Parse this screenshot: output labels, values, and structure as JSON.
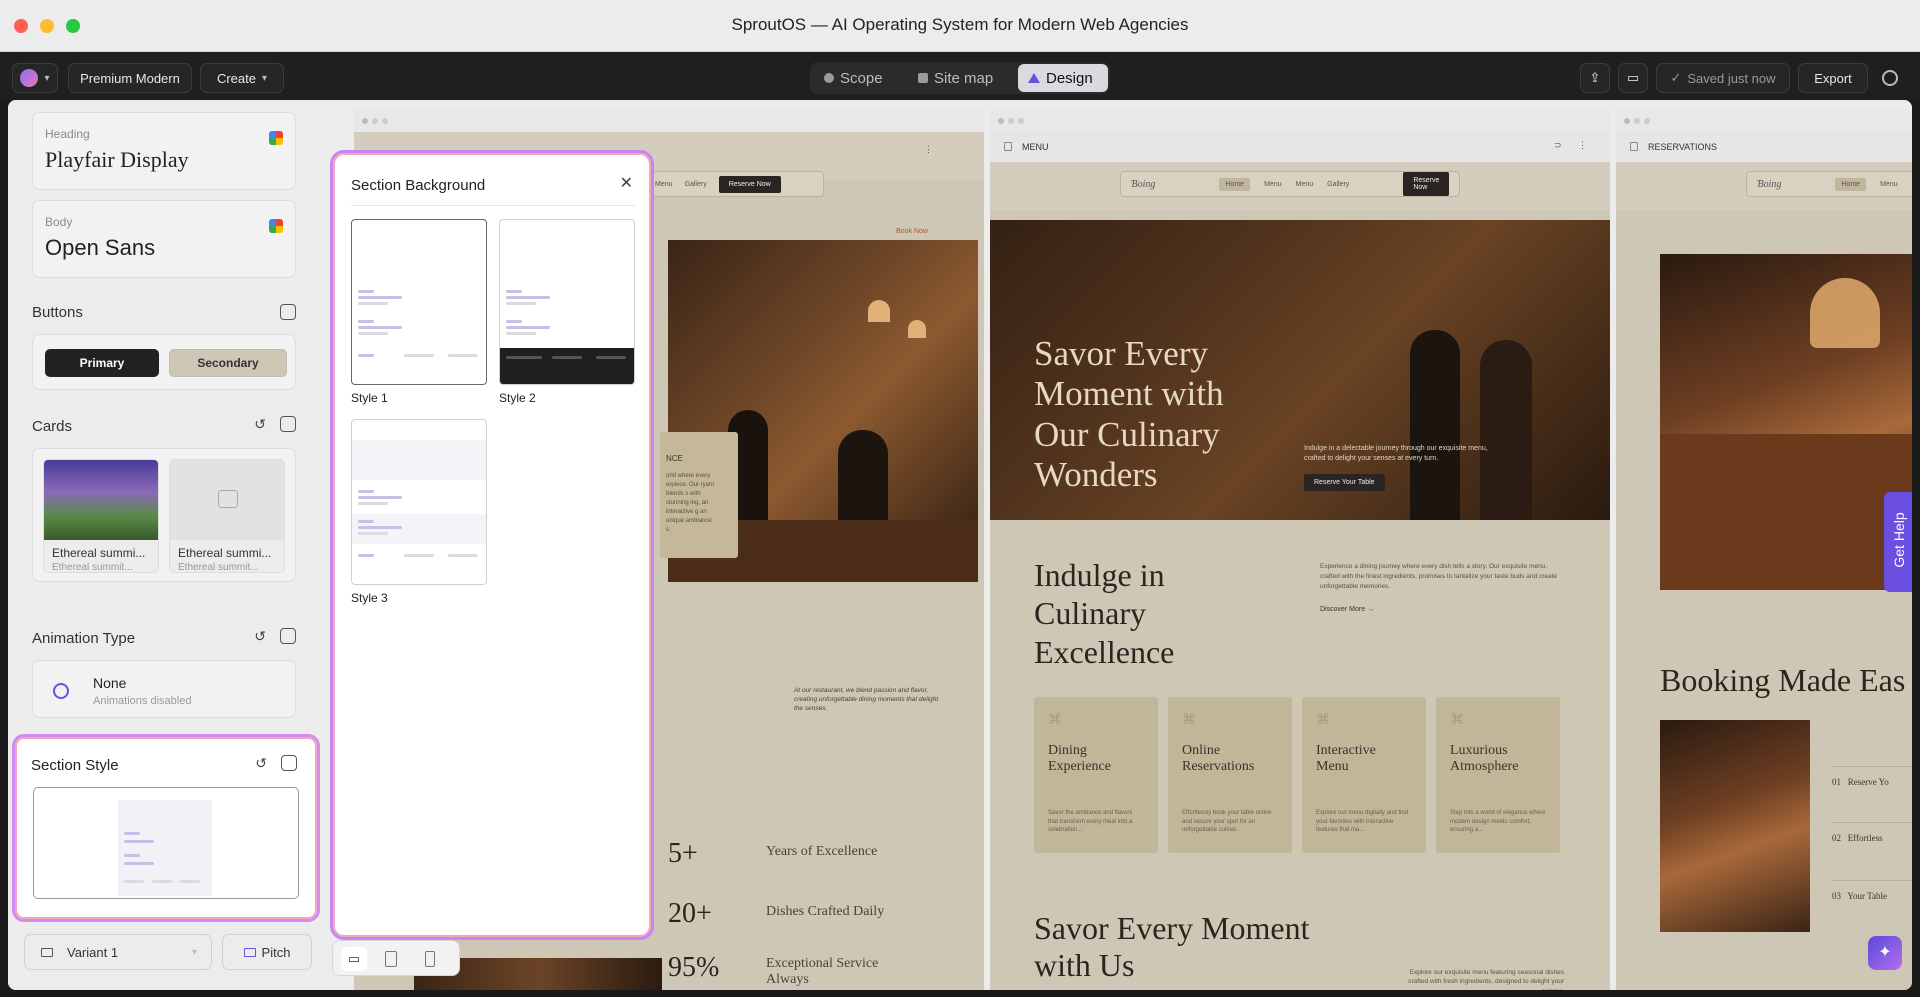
{
  "window": {
    "title": "SproutOS — AI Operating System for Modern Web Agencies"
  },
  "toolbar": {
    "theme_label": "Premium Modern",
    "create_label": "Create",
    "tabs": [
      {
        "label": "Scope"
      },
      {
        "label": "Site map"
      },
      {
        "label": "Design"
      }
    ],
    "saved_label": "Saved just now",
    "export_label": "Export"
  },
  "sidebar": {
    "heading_font": {
      "label": "Heading",
      "value": "Playfair Display"
    },
    "body_font": {
      "label": "Body",
      "value": "Open Sans"
    },
    "buttons": {
      "title": "Buttons",
      "primary": "Primary",
      "secondary": "Secondary"
    },
    "cards": {
      "title": "Cards",
      "items": [
        {
          "title": "Ethereal summi...",
          "subtitle": "Ethereal summit..."
        },
        {
          "title": "Ethereal summi...",
          "subtitle": "Ethereal summit..."
        }
      ]
    },
    "animation": {
      "title": "Animation Type",
      "value": "None",
      "desc": "Animations disabled"
    },
    "section_style": {
      "title": "Section Style"
    },
    "variant_label": "Variant 1",
    "pitch_label": "Pitch"
  },
  "popover": {
    "title": "Section Background",
    "styles": [
      {
        "label": "Style 1"
      },
      {
        "label": "Style 2"
      },
      {
        "label": "Style 3"
      }
    ]
  },
  "preview1": {
    "nav": [
      "Menu",
      "Gallery"
    ],
    "nav_button": "Reserve Now",
    "book_link": "Book Now",
    "partial_heading": "NCE",
    "partial_text": "orld where every erpiece. Our ryant blends s with stunning ing, an interactive g an unique ambiance s.",
    "body_text": "At our restaurant, we blend passion and flavor, creating unforgettable dining moments that delight the senses.",
    "stats": [
      {
        "value": "5+",
        "label": "Years of Excellence"
      },
      {
        "value": "20+",
        "label": "Dishes Crafted Daily"
      },
      {
        "value": "95%",
        "label": "Exceptional Service Always"
      }
    ]
  },
  "preview2": {
    "page_label": "MENU",
    "logo": "Ɓoing",
    "nav": [
      "Home",
      "Menu",
      "Menu",
      "Gallery"
    ],
    "nav_button": "Reserve Now",
    "hero_title": "Savor Every Moment with Our Culinary Wonders",
    "hero_text": "Indulge in a delectable journey through our exquisite menu, crafted to delight your senses at every turn.",
    "hero_button": "Reserve Your Table",
    "section_title": "Indulge in Culinary Excellence",
    "section_text": "Experience a dining journey where every dish tells a story. Our exquisite menu, crafted with the finest ingredients, promises to tantalize your taste buds and create unforgettable memories.",
    "discover_link": "Discover More",
    "features": [
      {
        "title": "Dining Experience",
        "desc": "Savor the ambiance and flavors that transform every meal into a celebration..."
      },
      {
        "title": "Online Reservations",
        "desc": "Effortlessly book your table online and secure your spot for an unforgettable culinar..."
      },
      {
        "title": "Interactive Menu",
        "desc": "Explore our menu digitally and find your favorites with interactive features that ma..."
      },
      {
        "title": "Luxurious Atmosphere",
        "desc": "Step into a world of elegance where modern design meets comfort, ensuring a..."
      }
    ],
    "bottom_title": "Savor Every Moment with Us",
    "bottom_text": "Explore our exquisite menu featuring seasonal dishes crafted with fresh ingredients, designed to delight your senses."
  },
  "preview3": {
    "page_label": "RESERVATIONS",
    "logo": "Ɓoing",
    "nav": [
      "Home",
      "Menu"
    ],
    "title": "Booking Made Eas",
    "steps": [
      {
        "num": "01",
        "label": "Reserve Yo"
      },
      {
        "num": "02",
        "label": "Effortless"
      },
      {
        "num": "03",
        "label": "Your Table"
      }
    ]
  },
  "get_help": "Get Help",
  "colors": {
    "accent": "#6b4fe0",
    "popover_border": "#c884f2",
    "site_bg": "#cfc7b5",
    "dark": "#2a2522"
  }
}
